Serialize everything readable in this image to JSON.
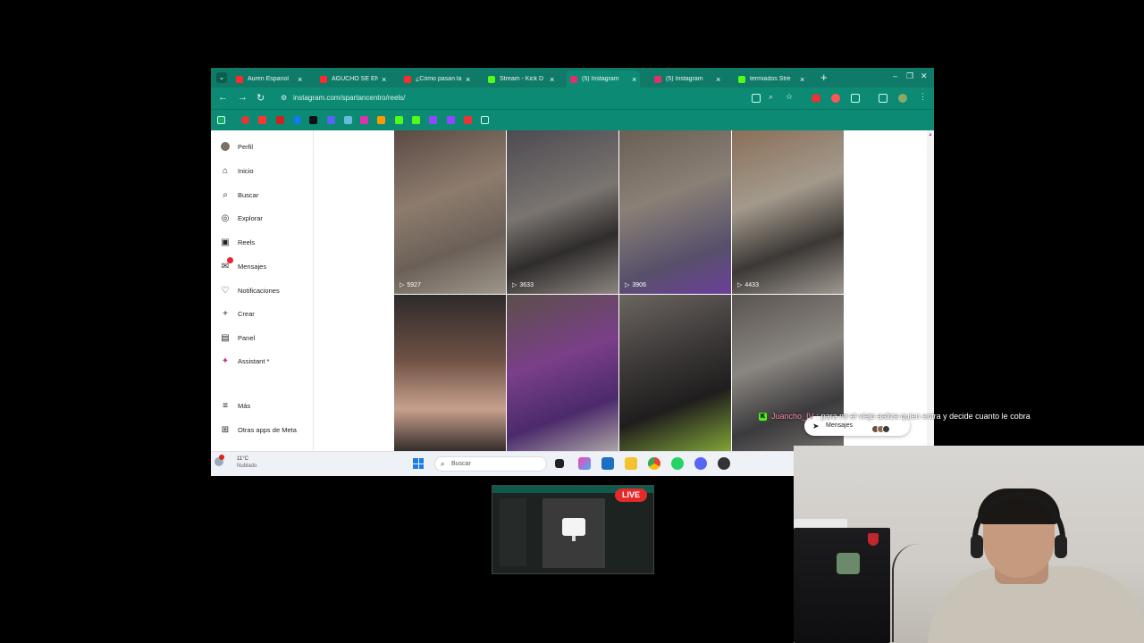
{
  "browser": {
    "tabs": [
      {
        "label": "Auren Espanol",
        "favicon": "youtube-icon",
        "color": "#ff2b2b",
        "active": false
      },
      {
        "label": "AGUCHO SE EN",
        "favicon": "youtube-icon",
        "color": "#ff2b2b",
        "active": false
      },
      {
        "label": "¿Cómo pasan la",
        "favicon": "youtube-icon",
        "color": "#ff2b2b",
        "active": false
      },
      {
        "label": "Stream - Kick D",
        "favicon": "kick-icon",
        "color": "#53fc18",
        "active": false
      },
      {
        "label": "(5) Instagram",
        "favicon": "instagram-icon",
        "color": "#e1306c",
        "active": true
      },
      {
        "label": "(5) Instagram",
        "favicon": "instagram-icon",
        "color": "#e1306c",
        "active": false
      },
      {
        "label": "termiados Stre",
        "favicon": "kick-icon",
        "color": "#53fc18",
        "active": false
      }
    ],
    "url": "instagram.com/spartancentro/reels/"
  },
  "sidebar": {
    "items": [
      {
        "label": "Perfil",
        "icon": "avatar-icon"
      },
      {
        "label": "Inicio",
        "icon": "home-icon"
      },
      {
        "label": "Buscar",
        "icon": "search-icon"
      },
      {
        "label": "Explorar",
        "icon": "compass-icon"
      },
      {
        "label": "Reels",
        "icon": "reels-icon"
      },
      {
        "label": "Mensajes",
        "icon": "messenger-icon",
        "badge": "1"
      },
      {
        "label": "Notificaciones",
        "icon": "heart-icon"
      },
      {
        "label": "Crear",
        "icon": "plus-icon"
      },
      {
        "label": "Panel",
        "icon": "dashboard-icon"
      },
      {
        "label": "Assistant *",
        "icon": "meta-ai-icon"
      }
    ],
    "bottom_items": [
      {
        "label": "Más",
        "icon": "menu-icon"
      },
      {
        "label": "Otras apps de Meta",
        "icon": "meta-apps-icon"
      }
    ]
  },
  "reels": [
    {
      "views": "5927"
    },
    {
      "views": "3633"
    },
    {
      "views": "3906"
    },
    {
      "views": "4433"
    },
    {
      "views": ""
    },
    {
      "views": ""
    },
    {
      "views": ""
    },
    {
      "views": ""
    }
  ],
  "messages_pill": {
    "label": "Mensajes"
  },
  "taskbar": {
    "weather_temp": "11°C",
    "weather_desc": "Nublado",
    "search_placeholder": "Buscar"
  },
  "chat": {
    "user": "Juancho_IV",
    "message": "para mi el viejo aaliza quien entra y decide cuanto le cobra"
  },
  "live_badge": "LIVE",
  "colors": {
    "browser_chrome": "#0c8a74",
    "tabbar": "#0f7a67",
    "live": "#e52a2a",
    "kick": "#53fc18"
  }
}
